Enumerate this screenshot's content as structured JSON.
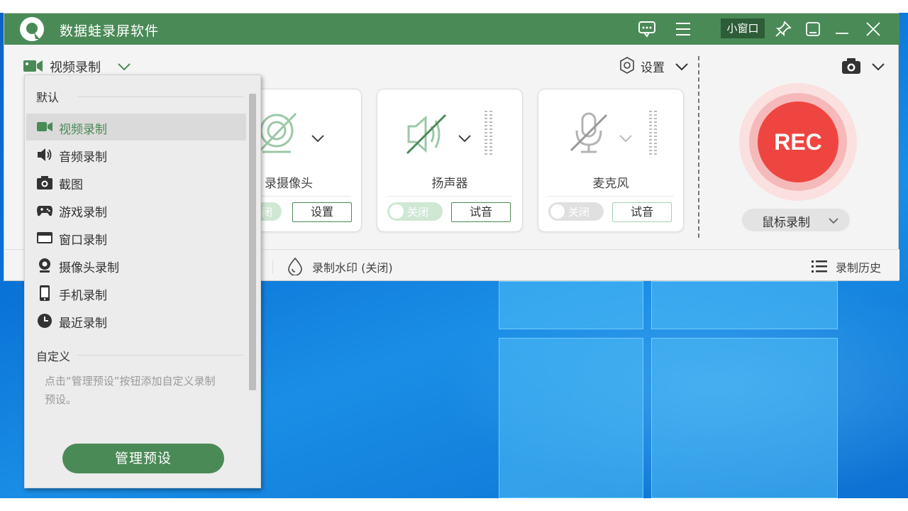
{
  "window": {
    "title": "数据蛙录屏软件",
    "mini_window_label": "小窗口",
    "brand_color": "#4a8a57"
  },
  "toolbar": {
    "video_record_label": "视频录制",
    "settings_label": "设置"
  },
  "cards": [
    {
      "name": "录摄像头",
      "toggle_label": "闭",
      "button_label": "设置",
      "icon": "webcam-disabled-icon"
    },
    {
      "name": "扬声器",
      "toggle_label": "关闭",
      "button_label": "试音",
      "icon": "speaker-muted-icon"
    },
    {
      "name": "麦克风",
      "toggle_label": "关闭",
      "button_label": "试音",
      "icon": "microphone-muted-icon"
    }
  ],
  "rec": {
    "label": "REC",
    "mode_label": "鼠标录制",
    "color": "#ef4540"
  },
  "bottombar": {
    "watermark_label": "录制水印 (关闭)",
    "history_label": "录制历史"
  },
  "dropdown": {
    "default_section": "默认",
    "items": [
      {
        "label": "视频录制",
        "icon": "video-camera-icon",
        "selected": true
      },
      {
        "label": "音频录制",
        "icon": "speaker-icon",
        "selected": false
      },
      {
        "label": "截图",
        "icon": "camera-icon",
        "selected": false
      },
      {
        "label": "游戏录制",
        "icon": "gamepad-icon",
        "selected": false
      },
      {
        "label": "窗口录制",
        "icon": "window-icon",
        "selected": false
      },
      {
        "label": "摄像头录制",
        "icon": "webcam-icon",
        "selected": false
      },
      {
        "label": "手机录制",
        "icon": "phone-icon",
        "selected": false
      },
      {
        "label": "最近录制",
        "icon": "clock-icon",
        "selected": false
      }
    ],
    "custom_section": "自定义",
    "hint": "点击“管理预设”按钮添加自定义录制预设。",
    "manage_button": "管理预设"
  }
}
